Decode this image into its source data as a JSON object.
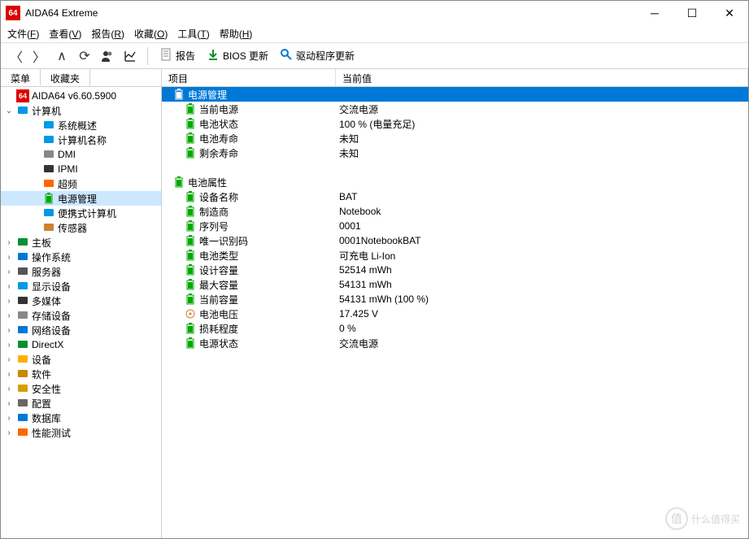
{
  "title": "AIDA64 Extreme",
  "app_icon_text": "64",
  "menubar": [
    {
      "label": "文件",
      "key": "F"
    },
    {
      "label": "查看",
      "key": "V"
    },
    {
      "label": "报告",
      "key": "R"
    },
    {
      "label": "收藏",
      "key": "O"
    },
    {
      "label": "工具",
      "key": "T"
    },
    {
      "label": "帮助",
      "key": "H"
    }
  ],
  "toolbar": {
    "report": "报告",
    "bios_update": "BIOS 更新",
    "driver_update": "驱动程序更新"
  },
  "tabs": {
    "menu": "菜单",
    "fav": "收藏夹"
  },
  "tree_root": "AIDA64 v6.60.5900",
  "tree_computer": "计算机",
  "tree_computer_children": [
    {
      "label": "系统概述",
      "icon": "monitor",
      "color": "#0099e5"
    },
    {
      "label": "计算机名称",
      "icon": "monitor",
      "color": "#0099e5"
    },
    {
      "label": "DMI",
      "icon": "chip",
      "color": "#888"
    },
    {
      "label": "IPMI",
      "icon": "chip-dark",
      "color": "#333"
    },
    {
      "label": "超频",
      "icon": "fire",
      "color": "#ff6600"
    },
    {
      "label": "电源管理",
      "icon": "battery",
      "color": "#0a0",
      "selected": true
    },
    {
      "label": "便携式计算机",
      "icon": "laptop",
      "color": "#0099e5"
    },
    {
      "label": "传感器",
      "icon": "sensor",
      "color": "#d08030"
    }
  ],
  "tree_siblings": [
    {
      "label": "主板",
      "icon": "board",
      "color": "#0a9030"
    },
    {
      "label": "操作系统",
      "icon": "windows",
      "color": "#0078d7"
    },
    {
      "label": "服务器",
      "icon": "server",
      "color": "#555"
    },
    {
      "label": "显示设备",
      "icon": "display",
      "color": "#0099e5"
    },
    {
      "label": "多媒体",
      "icon": "speaker",
      "color": "#333"
    },
    {
      "label": "存储设备",
      "icon": "disk",
      "color": "#888"
    },
    {
      "label": "网络设备",
      "icon": "network",
      "color": "#0078d7"
    },
    {
      "label": "DirectX",
      "icon": "directx",
      "color": "#0a9030"
    },
    {
      "label": "设备",
      "icon": "devices",
      "color": "#ffb000"
    },
    {
      "label": "软件",
      "icon": "software",
      "color": "#cc8800"
    },
    {
      "label": "安全性",
      "icon": "shield",
      "color": "#d4a000"
    },
    {
      "label": "配置",
      "icon": "config",
      "color": "#666"
    },
    {
      "label": "数据库",
      "icon": "database",
      "color": "#0078d7"
    },
    {
      "label": "性能测试",
      "icon": "benchmark",
      "color": "#ff6600"
    }
  ],
  "columns": {
    "item": "项目",
    "value": "当前值"
  },
  "groups": [
    {
      "header": "电源管理",
      "selected": true,
      "rows": [
        {
          "label": "当前电源",
          "value": "交流电源"
        },
        {
          "label": "电池状态",
          "value": "100 % (电量充足)"
        },
        {
          "label": "电池寿命",
          "value": "未知"
        },
        {
          "label": "剩余寿命",
          "value": "未知"
        }
      ]
    },
    {
      "header": "电池属性",
      "rows": [
        {
          "label": "设备名称",
          "value": "BAT"
        },
        {
          "label": "制造商",
          "value": "Notebook"
        },
        {
          "label": "序列号",
          "value": "0001"
        },
        {
          "label": "唯一识别码",
          "value": "0001NotebookBAT"
        },
        {
          "label": "电池类型",
          "value": "可充电 Li-Ion"
        },
        {
          "label": "设计容量",
          "value": "52514 mWh"
        },
        {
          "label": "最大容量",
          "value": "54131 mWh"
        },
        {
          "label": "当前容量",
          "value": "54131 mWh  (100 %)"
        },
        {
          "label": "电池电压",
          "value": "17.425 V",
          "icon": "voltage"
        },
        {
          "label": "损耗程度",
          "value": "0 %"
        },
        {
          "label": "电源状态",
          "value": "交流电源"
        }
      ]
    }
  ],
  "watermark": "什么值得买",
  "watermark_badge": "值"
}
